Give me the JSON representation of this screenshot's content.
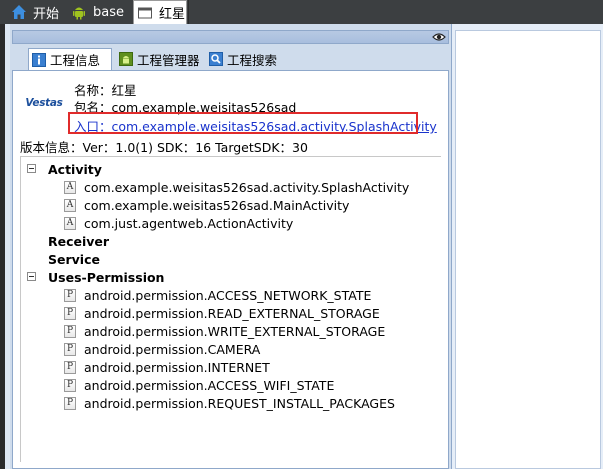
{
  "doc_tabs": [
    {
      "label": "开始",
      "icon": "home-icon"
    },
    {
      "label": "base",
      "icon": "android-icon"
    },
    {
      "label": "红星",
      "icon": "window-icon"
    }
  ],
  "inner_tabs": [
    {
      "label": "工程信息",
      "icon": "info-icon"
    },
    {
      "label": "工程管理器",
      "icon": "android-icon"
    },
    {
      "label": "工程搜索",
      "icon": "search-icon"
    }
  ],
  "app_info": {
    "logo_text": "Vestas",
    "name": "名称：红星",
    "package": "包名：com.example.weisitas526sad",
    "entry": "入口：com.example.weisitas526sad.activity.SplashActivity",
    "version": "版本信息：Ver：1.0(1) SDK：16 TargetSDK：30"
  },
  "tree": {
    "activity_label": "Activity",
    "activities": [
      "com.example.weisitas526sad.activity.SplashActivity",
      "com.example.weisitas526sad.MainActivity",
      "com.just.agentweb.ActionActivity"
    ],
    "receiver_label": "Receiver",
    "service_label": "Service",
    "permission_label": "Uses-Permission",
    "permissions": [
      "android.permission.ACCESS_NETWORK_STATE",
      "android.permission.READ_EXTERNAL_STORAGE",
      "android.permission.WRITE_EXTERNAL_STORAGE",
      "android.permission.CAMERA",
      "android.permission.INTERNET",
      "android.permission.ACCESS_WIFI_STATE",
      "android.permission.REQUEST_INSTALL_PACKAGES"
    ],
    "activity_icon_letter": "A",
    "permission_icon_letter": "P"
  },
  "colors": {
    "link": "#1a33cc",
    "highlight_box": "#e02b2b",
    "panel_bg": "#cfdcec"
  }
}
